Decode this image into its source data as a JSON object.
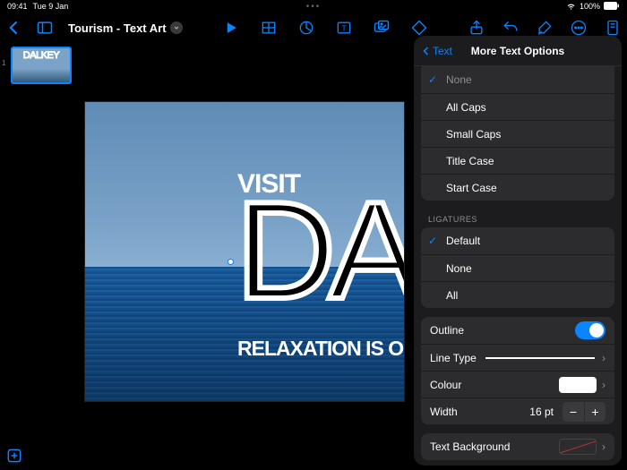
{
  "status": {
    "time": "09:41",
    "date": "Tue 9 Jan",
    "battery": "100%"
  },
  "doc": {
    "title": "Tourism - Text Art"
  },
  "thumbnail": {
    "word": "DALKEY",
    "num": "1"
  },
  "slide": {
    "visit": "VISIT",
    "main": "DALKEY",
    "tagline": "RELAXATION IS ON THE HORIZON"
  },
  "popover": {
    "back": "Text",
    "title": "More Text Options",
    "caps": {
      "none": "None",
      "allcaps": "All Caps",
      "smallcaps": "Small Caps",
      "titlecase": "Title Case",
      "startcase": "Start Case"
    },
    "ligatures": {
      "header": "Ligatures",
      "default": "Default",
      "none": "None",
      "all": "All"
    },
    "outline": {
      "label": "Outline",
      "linetype": "Line Type",
      "colour": "Colour",
      "width_label": "Width",
      "width_value": "16 pt"
    },
    "textbg": {
      "label": "Text Background"
    }
  }
}
